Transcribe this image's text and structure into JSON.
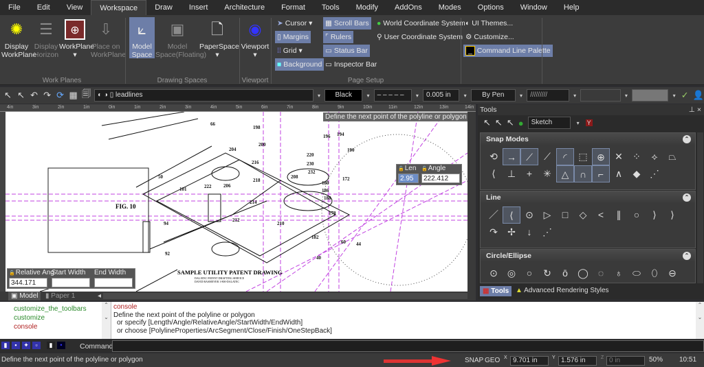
{
  "menu": [
    "File",
    "Edit",
    "View",
    "Workspace",
    "Draw",
    "Insert",
    "Architecture",
    "Format",
    "Tools",
    "Modify",
    "AddOns",
    "Modes",
    "Options",
    "Window",
    "Help"
  ],
  "ribbon": {
    "work_planes": {
      "label": "Work Planes",
      "display_workplane": "Display WorkPlane",
      "display_horizon": "Display Horizon",
      "workplane": "WorkPlane",
      "place_on": "Place on WorkPlane"
    },
    "drawing_spaces": {
      "label": "Drawing Spaces",
      "model_space": "Model Space",
      "model_space_floating": "Model Space(Floating)",
      "paperspace": "PaperSpace"
    },
    "viewport": {
      "label": "Viewport",
      "viewport": "Viewport"
    },
    "page_setup": {
      "label": "Page Setup",
      "cursor": "Cursor",
      "margins": "Margins",
      "grid": "Grid",
      "background": "Background",
      "scroll_bars": "Scroll Bars",
      "rulers": "Rulers",
      "status_bar": "Status Bar",
      "inspector_bar": "Inspector Bar",
      "wcs": "World Coordinate System",
      "ucs": "User Coordinate System"
    },
    "ui": {
      "themes": "UI Themes...",
      "customize": "Customize...",
      "command_line_palette": "Command Line Palette"
    }
  },
  "toolbar": {
    "layer": "leadlines",
    "color": "Black",
    "line_weight": "0.005 in",
    "pen": "By Pen"
  },
  "ruler": [
    "4in",
    "3in",
    "2in",
    "1in",
    "0in",
    "1in",
    "2in",
    "3in",
    "4in",
    "5in",
    "6in",
    "7in",
    "8in",
    "9in",
    "10in",
    "11in",
    "12in",
    "13in",
    "14in"
  ],
  "drawing": {
    "fig": "FIG. 10",
    "title": "SAMPLE UTILITY PATENT DRAWING",
    "sub1": "DALATEC PATENT DRAFTING SERVICE",
    "sub2": "DAVID RASMEYER 1-800-DALATEC",
    "parts": [
      "66",
      "198",
      "200",
      "204",
      "216",
      "220",
      "230",
      "232",
      "218",
      "208",
      "206",
      "222",
      "50",
      "101",
      "214",
      "212",
      "210",
      "94",
      "92",
      "178",
      "172",
      "180",
      "186",
      "188",
      "190",
      "194",
      "196",
      "182",
      "40",
      "44",
      "60"
    ]
  },
  "tooltip": "Define the next point of the polyline or polygon",
  "inputs": {
    "length_label": "Len",
    "length_value": "2.95",
    "angle_label": "Angle",
    "angle_value": "222.412",
    "rel_angle_label": "Relative Ang",
    "rel_angle_value": "344.171",
    "start_width_label": "Start Width",
    "end_width_label": "End Width"
  },
  "tabs": {
    "model": "Model",
    "paper": "Paper 1"
  },
  "tools_panel": {
    "title": "Tools",
    "mode": "Sketch",
    "snap_modes": "Snap Modes",
    "line": "Line",
    "circle": "Circle/Ellipse",
    "tab_tools": "Tools",
    "tab_ars": "Advanced Rendering Styles"
  },
  "console": {
    "tree": [
      "customize_the_toolbars",
      "customize",
      "console"
    ],
    "lines": [
      "console",
      "Define the next point of the polyline or polygon",
      "or specify [Length/Angle/RelativeAngle/StartWidth/EndWidth]",
      "or choose [PolylineProperties/ArcSegment/Close/Finish/OneStepBack]"
    ]
  },
  "command": {
    "label": "Command:",
    "value": ""
  },
  "status": {
    "prompt": "Define the next point of the polyline or polygon",
    "snap": "SNAP",
    "geo": "GEO",
    "x": "9.701 in",
    "y": "1.576 in",
    "z": "0 in",
    "zoom": "50%",
    "time": "10:51"
  }
}
